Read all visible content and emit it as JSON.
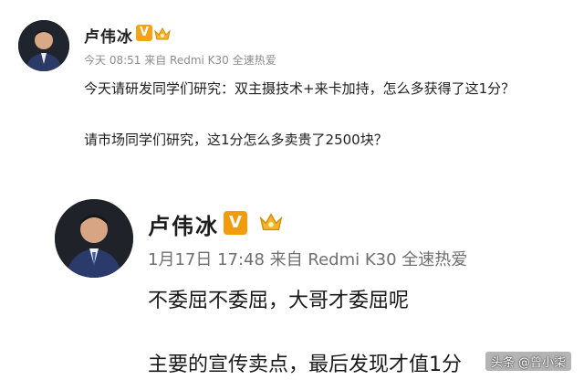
{
  "post_small": {
    "author": "卢伟冰",
    "verified_badge": "V",
    "meta": "今天 08:51 来自 Redmi K30 全速热爱",
    "text_line1": "今天请研发同学们研究：双主摄技术+来卡加持，怎么多获得了这1分？",
    "text_line2": "请市场同学们研究，这1分怎么多卖贵了2500块？"
  },
  "post_large": {
    "author": "卢伟冰",
    "verified_badge": "V",
    "meta": "1月17日 17:48 来自 Redmi K30 全速热爱",
    "text_line1": "不委屈不委屈，大哥才委屈呢",
    "text_line2": "主要的宣传卖点，最后发现才值1分"
  },
  "watermark": "头条 @曾小柒",
  "colors": {
    "badge_orange": "#f29b0c",
    "meta_gray": "#8c8c8c"
  }
}
